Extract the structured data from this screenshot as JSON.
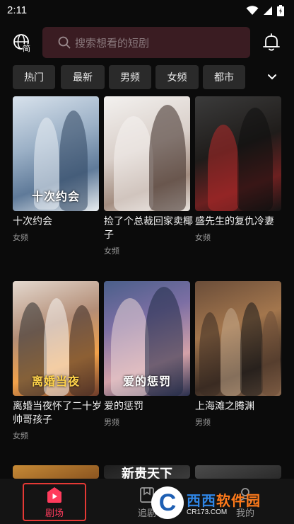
{
  "status_bar": {
    "time": "2:11"
  },
  "header": {
    "search_placeholder": "搜索想看的短剧",
    "lang_icon": "globe-icon",
    "lang_badge": "简",
    "bell_icon": "bell-icon"
  },
  "tabs": [
    "热门",
    "最新",
    "男频",
    "女频",
    "都市"
  ],
  "cards": [
    {
      "title": "十次约会",
      "genre": "女频",
      "poster_text": "十次约会"
    },
    {
      "title": "捡了个总裁回家卖椰子",
      "genre": "女频",
      "poster_text": ""
    },
    {
      "title": "盛先生的复仇冷妻",
      "genre": "女频",
      "poster_text": ""
    },
    {
      "title": "离婚当夜怀了二十岁帅哥孩子",
      "genre": "女频",
      "poster_text": "离婚当夜"
    },
    {
      "title": "爱的惩罚",
      "genre": "男频",
      "poster_text": "爱的惩罚"
    },
    {
      "title": "上海滩之腾渊",
      "genre": "男频",
      "poster_text": ""
    }
  ],
  "partial_posters": [
    {
      "poster_text": ""
    },
    {
      "poster_text": "新贵天下"
    },
    {
      "poster_text": ""
    }
  ],
  "bottom_nav": [
    {
      "label": "剧场",
      "icon": "play-square-icon",
      "active": true
    },
    {
      "label": "追剧",
      "icon": "bookmark-icon",
      "active": false
    },
    {
      "label": "我的",
      "icon": "user-icon",
      "active": false
    }
  ],
  "watermark": {
    "brand": "西西软件园",
    "brand_a": "西西",
    "brand_b": "软件园",
    "domain": "CR173.COM",
    "mark": "C"
  },
  "colors": {
    "accent": "#ff3b5c",
    "search_bg": "#3a1c22",
    "tab_bg": "#2a2a2a",
    "highlight": "#e53935"
  }
}
